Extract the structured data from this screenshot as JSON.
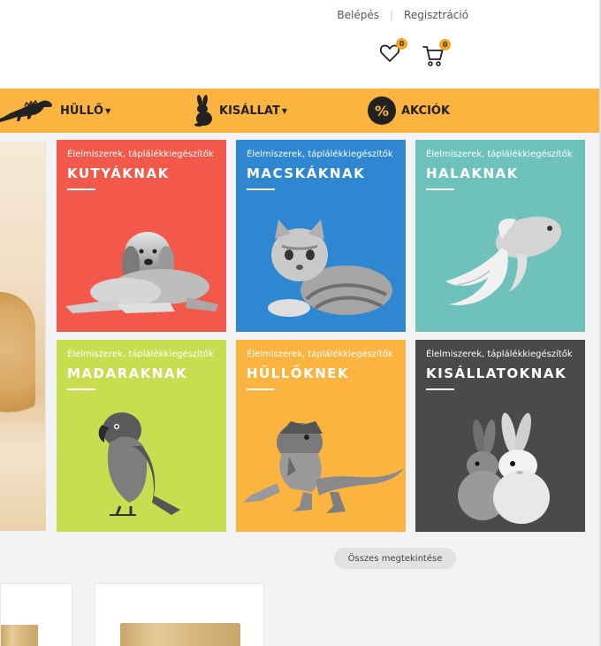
{
  "header": {
    "login": "Belépés",
    "register": "Regisztráció",
    "wishlist_count": "0",
    "cart_count": "0"
  },
  "nav": {
    "items": [
      {
        "label": "HÜLLŐ",
        "icon": "iguana-icon"
      },
      {
        "label": "KISÁLLAT",
        "icon": "rabbit-icon"
      },
      {
        "label": "AKCIÓK",
        "icon": "percent-icon"
      }
    ],
    "promo_symbol": "%"
  },
  "categories": [
    {
      "subtitle": "Élelmiszerek, táplálékkiegészítők",
      "title": "KUTYÁKNAK",
      "color": "#f2594b",
      "icon": "dog-icon"
    },
    {
      "subtitle": "Élelmiszerek, táplálékkiegészítők",
      "title": "MACSKÁKNAK",
      "color": "#2f86d1",
      "icon": "cat-icon"
    },
    {
      "subtitle": "Élelmiszerek, táplálékkiegészítők",
      "title": "HALAKNAK",
      "color": "#6fc2bb",
      "icon": "fish-icon"
    },
    {
      "subtitle": "Élelmiszerek, táplálékkiegészítők",
      "title": "MADARAKNAK",
      "color": "#c8dd4f",
      "icon": "parrot-icon"
    },
    {
      "subtitle": "Élelmiszerek, táplálékkiegészítők",
      "title": "HÜLLŐKNEK",
      "color": "#fcb441",
      "icon": "lizard-icon"
    },
    {
      "subtitle": "Élelmiszerek, táplálékkiegészítők",
      "title": "KISÁLLATOKNAK",
      "color": "#4a4a4a",
      "icon": "rabbits-icon"
    }
  ],
  "products": {
    "view_all": "Összes megtekintése"
  }
}
